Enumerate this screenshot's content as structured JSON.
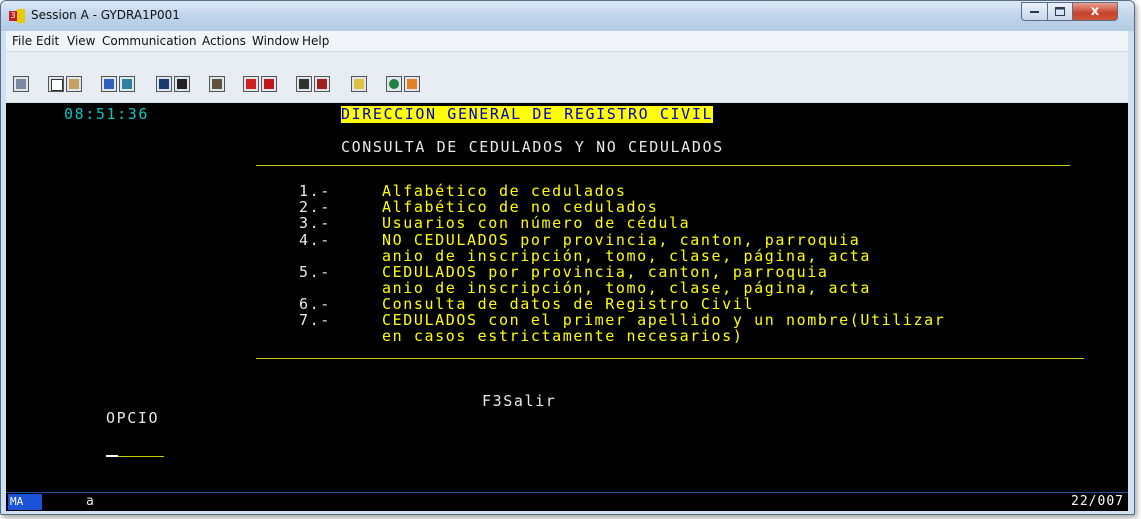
{
  "window": {
    "title": "Session A - GYDRA1P001",
    "min_icon": "minimize-icon",
    "max_icon": "maximize-icon",
    "close_icon": "close-icon",
    "close_glyph": "x"
  },
  "menu": [
    "File",
    "Edit",
    "View",
    "Communication",
    "Actions",
    "Window",
    "Help"
  ],
  "toolbar_icons": [
    "print-screen-icon",
    "copy-icon",
    "paste-icon",
    "send-file-icon",
    "receive-file-icon",
    "display-icon",
    "record-icon",
    "macro-icon",
    "play-macro-icon",
    "stop-macro-icon",
    "run-icon",
    "stop-run-icon",
    "clipboard-icon",
    "connect-icon",
    "disconnect-icon"
  ],
  "screen": {
    "time": "08:51:36",
    "header": "DIRECCION GENERAL DE REGISTRO CIVIL",
    "subtitle": "CONSULTA DE CEDULADOS Y NO CEDULADOS",
    "options": [
      {
        "num": "1.-",
        "lines": [
          "Alfabético de cedulados"
        ]
      },
      {
        "num": "2.-",
        "lines": [
          "Alfabético de no cedulados"
        ]
      },
      {
        "num": "3.-",
        "lines": [
          "Usuarios con número de cédula"
        ]
      },
      {
        "num": "4.-",
        "lines": [
          "NO CEDULADOS por provincia, canton, parroquia",
          "anio de inscripción, tomo, clase, página, acta"
        ]
      },
      {
        "num": "5.-",
        "lines": [
          "CEDULADOS por provincia, canton, parroquia",
          "anio de inscripción, tomo, clase, página, acta"
        ]
      },
      {
        "num": "6.-",
        "lines": [
          "Consulta de datos de Registro Civil"
        ]
      },
      {
        "num": "7.-",
        "lines": [
          "CEDULADOS con el primer apellido y un nombre(Utilizar",
          "en casos estrictamente necesarios)"
        ]
      }
    ],
    "fkey": "F3Salir",
    "opcion_label": "OPCIO",
    "input_value": ""
  },
  "status": {
    "mode": "MA",
    "field": "a",
    "cursor": "22/007"
  },
  "colors": {
    "screen_bg": "#000000",
    "green": "#00c8c8",
    "yellow": "#ffff00",
    "header_text": "#0000c8"
  }
}
